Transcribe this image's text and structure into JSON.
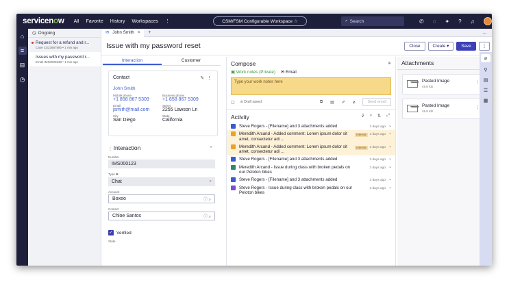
{
  "topbar": {
    "logo_main": "servicen",
    "logo_o": "o",
    "logo_end": "w",
    "nav": [
      "All",
      "Favorite",
      "History",
      "Workspaces",
      "⋮"
    ],
    "workspace": "CSM/FSM Configurable Workspace ☆",
    "search_placeholder": "Search"
  },
  "list": {
    "header": "Ongoing",
    "items": [
      {
        "title": "Request for a refund and r...",
        "sub": "Case  CS23567890  •  1 min ago"
      },
      {
        "title": "Issues with my password r...",
        "sub": "Email  IMS0000238  •  1 min ago"
      }
    ]
  },
  "tabs": {
    "active": "John Smith",
    "close": "×",
    "add": "+",
    "more": "..."
  },
  "record": {
    "title": "Issue with my password reset",
    "buttons": {
      "close": "Close",
      "create": "Create ▾",
      "save": "Save",
      "more": "⋮"
    }
  },
  "subtabs": [
    "Interaction",
    "Customer"
  ],
  "contact": {
    "heading": "Contact",
    "name": "John Smith",
    "fields": [
      {
        "label": "Mobile phone",
        "value": "+1 858 867 5309",
        "link": true
      },
      {
        "label": "Business phone",
        "value": "+1 858 867 5309",
        "link": true
      },
      {
        "label": "Email",
        "value": "jsmith@mail.com",
        "link": true
      },
      {
        "label": "Street",
        "value": "2255 Lawson Ln",
        "link": false
      },
      {
        "label": "City",
        "value": "San Diego",
        "link": false
      },
      {
        "label": "State",
        "value": "California",
        "link": false
      }
    ]
  },
  "interaction": {
    "heading": "Interaction",
    "number_label": "Number",
    "number": "IMS000123",
    "type_label": "Type ✱",
    "type": "Chat",
    "account_label": "Account",
    "account": "Boxeo",
    "contact_label": "Contact",
    "contact": "Chloe Santos",
    "verified": "Verified",
    "state_label": "State"
  },
  "compose": {
    "heading": "Compose",
    "tab_notes": "Work notes (Private)",
    "tab_email": "Email",
    "placeholder": "Type your work notes here",
    "draft": "Draft saved",
    "send": "Send email"
  },
  "activity": {
    "heading": "Activity",
    "rows": [
      {
        "icon": "blue",
        "text": "Steve Rogers - [Filename] and 3 attachments added",
        "badge": "",
        "time": "3 days ago",
        "hl": false
      },
      {
        "icon": "orange",
        "text": "Meredith Arcand - Added comment: Lorem ipsum dolor sit amet, consectetur adi ...",
        "badge": "Internal",
        "time": "3 days ago",
        "hl": true
      },
      {
        "icon": "orange",
        "text": "Meredith Arcand - Added comment: Lorem ipsum dolor sit amet, consectetur adi ...",
        "badge": "Internal",
        "time": "3 days ago",
        "hl": true
      },
      {
        "icon": "blue",
        "text": "Steve Rogers - [Filename] and 3 attachments added",
        "badge": "",
        "time": "3 days ago",
        "hl": false
      },
      {
        "icon": "green",
        "text": "Meredith Arcand - Issue during class with broken pedals on our Peloton bikes",
        "badge": "",
        "time": "3 days ago",
        "hl": false
      },
      {
        "icon": "blue",
        "text": "Steve Rogers - [Filename] and 3 attachments added",
        "badge": "",
        "time": "3 days ago",
        "hl": false
      },
      {
        "icon": "purple",
        "text": "Steve Rogers - Issue during class with broken pedals on our Peloton bikes",
        "badge": "",
        "time": "3 days ago",
        "hl": false
      }
    ]
  },
  "attachments": {
    "heading": "Attachments",
    "items": [
      {
        "name": "Pasted Image",
        "size": "49.8 KB"
      },
      {
        "name": "Pasted Image",
        "size": "49.8 KB"
      }
    ]
  },
  "icons": {
    "pencil": "✎",
    "kebab": "⋮",
    "chevron_up": "⌃",
    "chevron_down": "⌄",
    "search": "⌕",
    "close": "×",
    "lock": "🔒",
    "mail": "✉",
    "filter": "⊽",
    "expand": "⤢",
    "sort": "⇅",
    "check": "✓"
  }
}
